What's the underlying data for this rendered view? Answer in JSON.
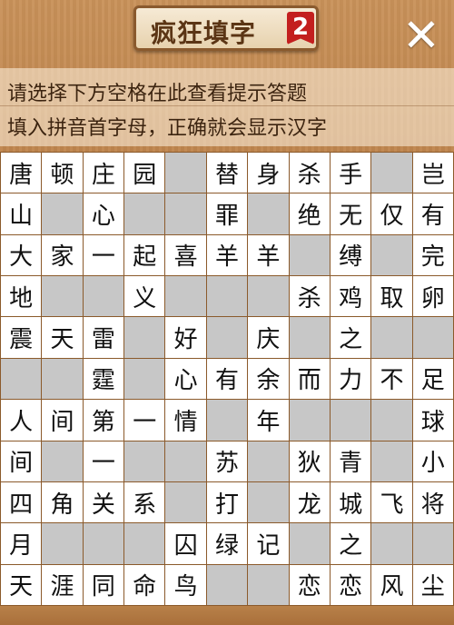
{
  "header": {
    "title": "疯狂填字",
    "level": "2",
    "close_glyph": "✕"
  },
  "hints": {
    "line1": "请选择下方空格在此查看提示答题",
    "line2": "填入拼音首字母，正确就会显示汉字"
  },
  "grid": [
    [
      "唐",
      "顿",
      "庄",
      "园",
      "",
      "替",
      "身",
      "杀",
      "手",
      "",
      "岂"
    ],
    [
      "山",
      "",
      "心",
      "",
      "",
      "罪",
      "",
      "绝",
      "无",
      "仅",
      "有"
    ],
    [
      "大",
      "家",
      "一",
      "起",
      "喜",
      "羊",
      "羊",
      "",
      "缚",
      "",
      "完"
    ],
    [
      "地",
      "",
      "",
      "义",
      "",
      "",
      "",
      "杀",
      "鸡",
      "取",
      "卵"
    ],
    [
      "震",
      "天",
      "雷",
      "",
      "好",
      "",
      "庆",
      "",
      "之",
      "",
      ""
    ],
    [
      "",
      "",
      "霆",
      "",
      "心",
      "有",
      "余",
      "而",
      "力",
      "不",
      "足"
    ],
    [
      "人",
      "间",
      "第",
      "一",
      "情",
      "",
      "年",
      "",
      "",
      "",
      "球"
    ],
    [
      "间",
      "",
      "一",
      "",
      "",
      "苏",
      "",
      "狄",
      "青",
      "",
      "小"
    ],
    [
      "四",
      "角",
      "关",
      "系",
      "",
      "打",
      "",
      "龙",
      "城",
      "飞",
      "将"
    ],
    [
      "月",
      "",
      "",
      "",
      "囚",
      "绿",
      "记",
      "",
      "之",
      "",
      ""
    ],
    [
      "天",
      "涯",
      "同",
      "命",
      "鸟",
      "",
      "",
      "恋",
      "恋",
      "风",
      "尘"
    ]
  ]
}
